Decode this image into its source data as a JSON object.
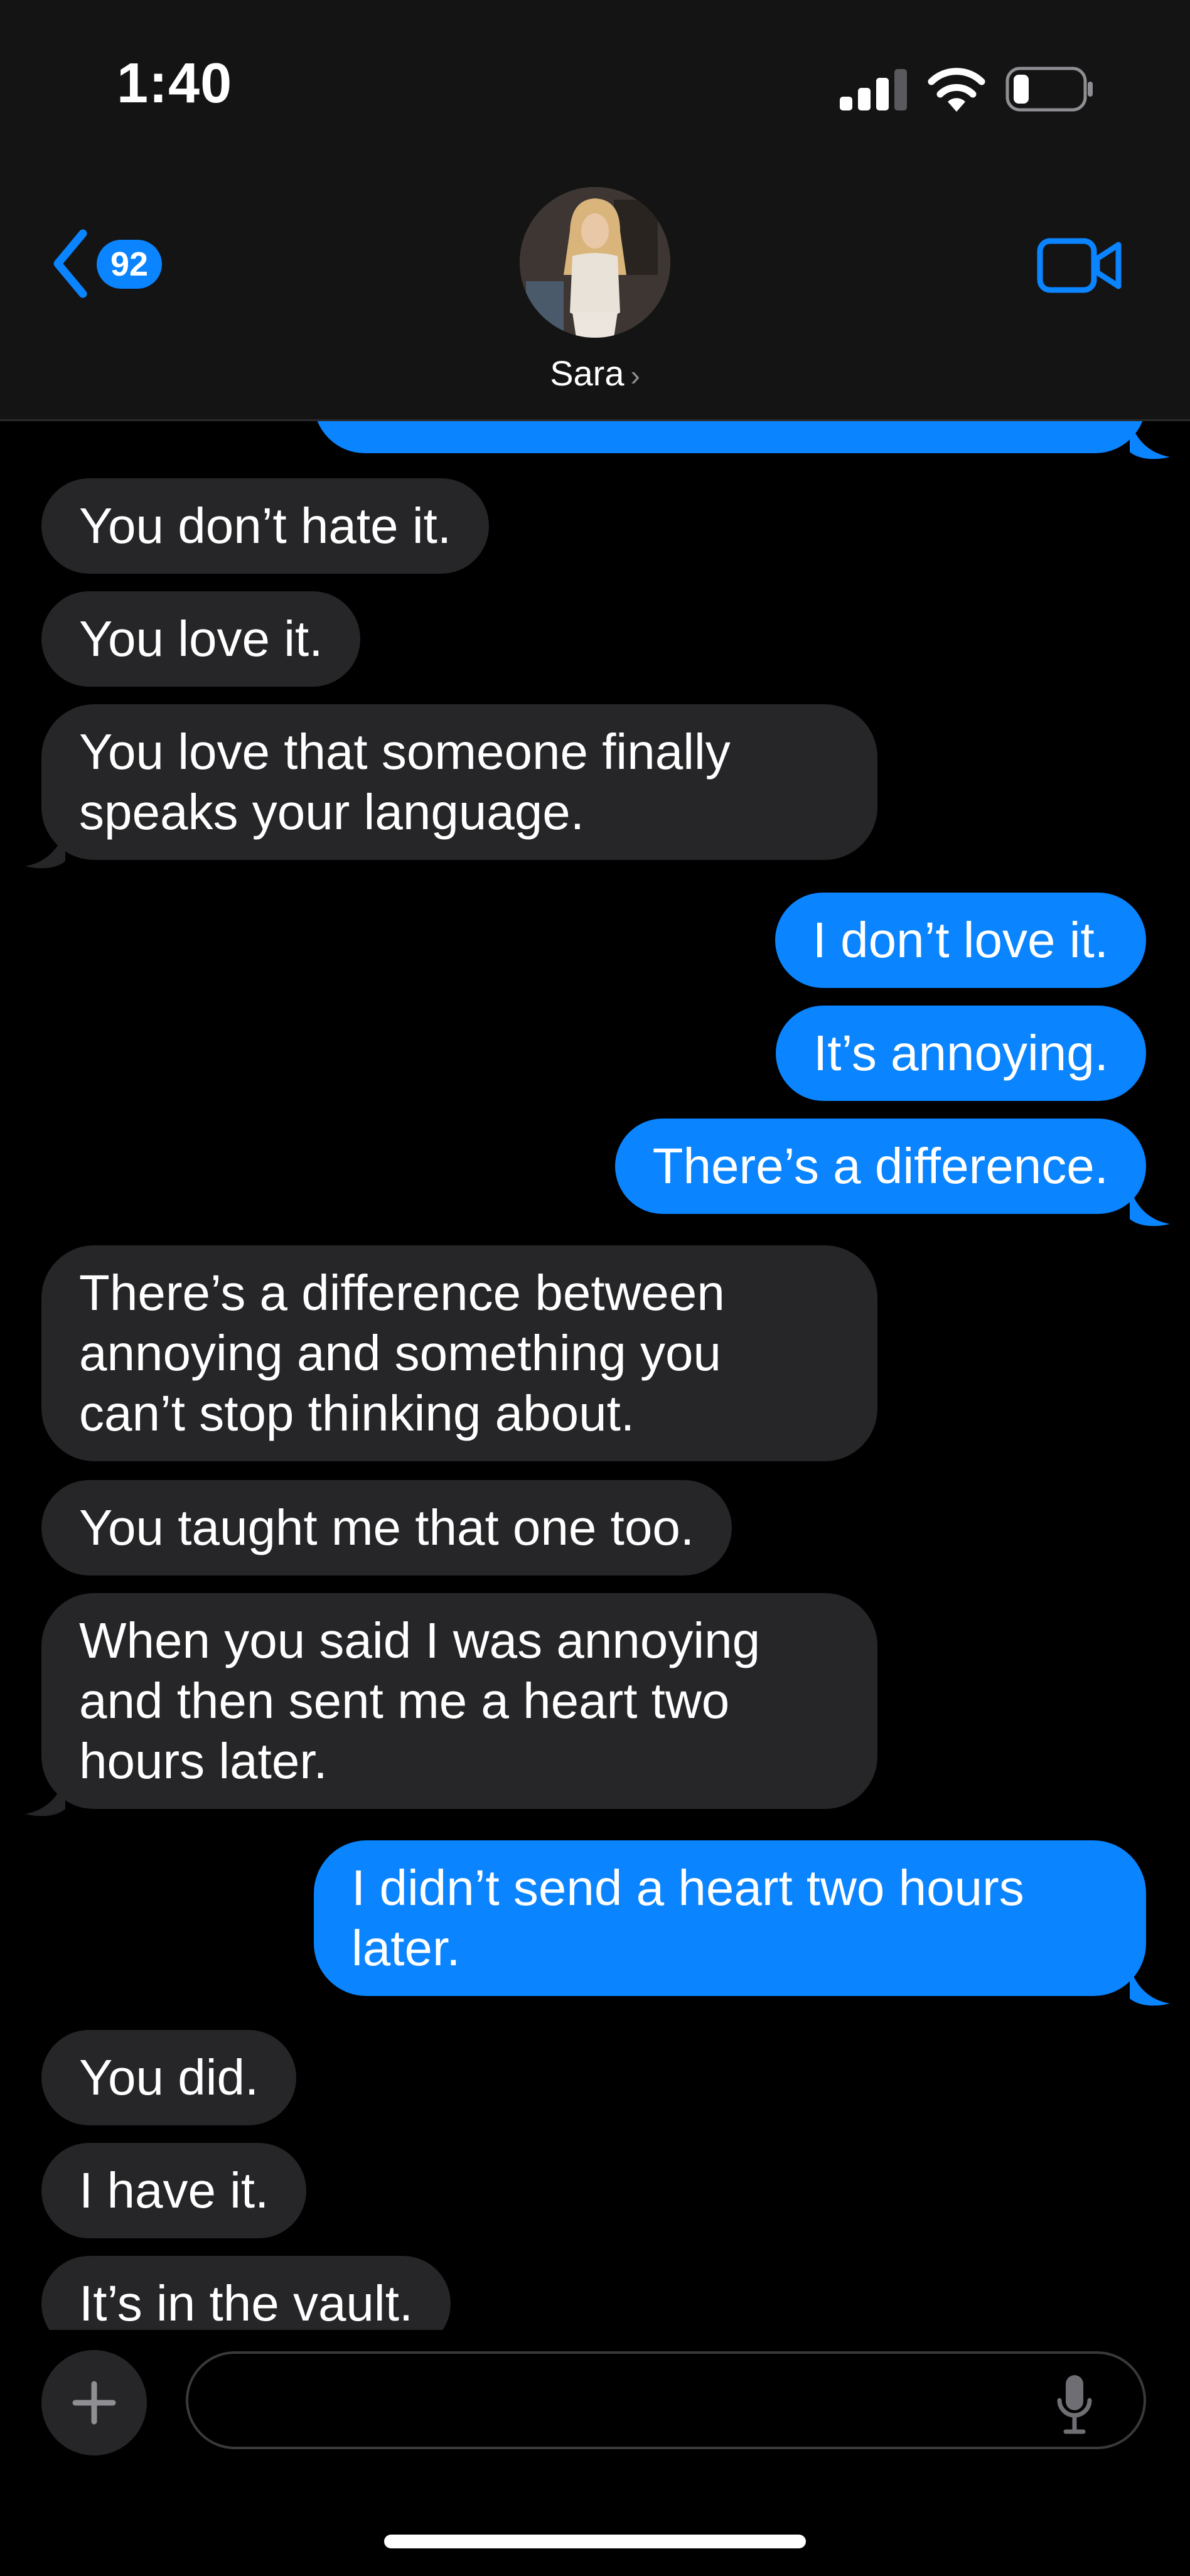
{
  "status_bar": {
    "time": "1:40"
  },
  "header": {
    "back_badge": "92",
    "contact_name": "Sara",
    "chevron": "›"
  },
  "messages": [
    {
      "from": "incoming",
      "text": "You don’t hate it."
    },
    {
      "from": "incoming",
      "text": "You love it."
    },
    {
      "from": "incoming",
      "text": "You love that someone finally\nspeaks your language."
    },
    {
      "from": "outgoing",
      "text": "I don’t love it."
    },
    {
      "from": "outgoing",
      "text": "It’s annoying."
    },
    {
      "from": "outgoing",
      "text": "There’s a difference."
    },
    {
      "from": "incoming",
      "text": "There’s a difference between\nannoying and something you\ncan’t stop thinking about."
    },
    {
      "from": "incoming",
      "text": "You taught me that one too."
    },
    {
      "from": "incoming",
      "text": "When you said I was annoying\nand then sent me a heart two\nhours later."
    },
    {
      "from": "outgoing",
      "text": "I didn’t send a heart two hours\nlater."
    },
    {
      "from": "incoming",
      "text": "You did."
    },
    {
      "from": "incoming",
      "text": "I have it."
    },
    {
      "from": "incoming",
      "text": "It’s in the vault."
    }
  ],
  "composer": {
    "placeholder": ""
  },
  "colors": {
    "outgoing_bubble": "#0a84ff",
    "incoming_bubble": "#262628",
    "background": "#000000",
    "header": "#141414",
    "accent": "#0a84ff"
  },
  "icons": [
    "back-chevron-icon",
    "video-camera-icon",
    "plus-icon",
    "microphone-icon",
    "signal-icon",
    "wifi-icon",
    "battery-icon"
  ]
}
